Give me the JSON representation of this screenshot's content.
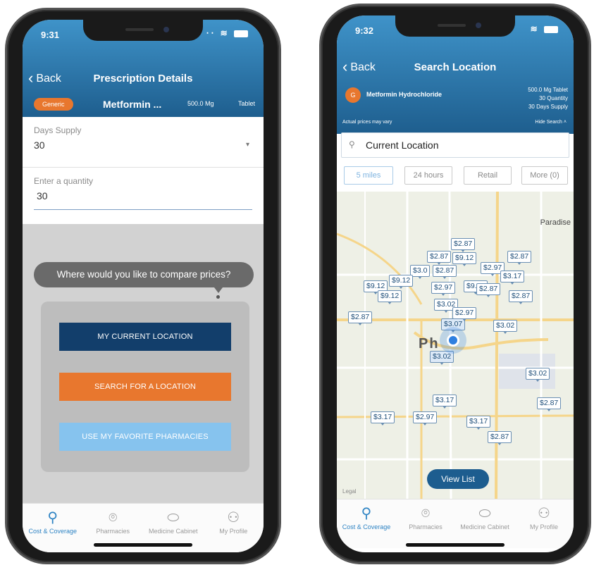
{
  "left_phone": {
    "status_time": "9:31",
    "back_label": "Back",
    "title": "Prescription Details",
    "generic_badge": "Generic",
    "drug_name": "Metformin ...",
    "dose": "500.0 Mg",
    "form": "Tablet",
    "days_supply_label": "Days Supply",
    "days_supply_value": "30",
    "quantity_label": "Enter a quantity",
    "quantity_value": "30",
    "compare_prompt": "Where would you like to compare prices?",
    "btn_current": "MY CURRENT LOCATION",
    "btn_search": "SEARCH FOR A LOCATION",
    "btn_favorite": "USE MY FAVORITE PHARMACIES"
  },
  "right_phone": {
    "status_time": "9:32",
    "back_label": "Back",
    "title": "Search Location",
    "drug_name": "Metformin Hydrochloride",
    "drug_badge": "G",
    "detail_line1": "500.0 Mg Tablet",
    "detail_line2": "30 Quantity",
    "detail_line3": "30 Days Supply",
    "disclaimer": "Actual prices may vary",
    "hide_search": "Hide Search",
    "search_value": "Current Location",
    "filters": [
      "5 miles",
      "24 hours",
      "Retail",
      "More (0)"
    ],
    "map_labels": {
      "paradise": "Paradise",
      "city": "Ph",
      "maps_mark": "Legal"
    },
    "price_pins": [
      {
        "price": "$2.87"
      },
      {
        "price": "$2.87"
      },
      {
        "price": "$9.12"
      },
      {
        "price": "$2.87"
      },
      {
        "price": "$2.97"
      },
      {
        "price": "$3.0"
      },
      {
        "price": "$2.87"
      },
      {
        "price": "$3.17"
      },
      {
        "price": "$9.12"
      },
      {
        "price": "$9.12"
      },
      {
        "price": "$2.97"
      },
      {
        "price": "$9.12"
      },
      {
        "price": "$2.87"
      },
      {
        "price": "$9.12"
      },
      {
        "price": "$2.87"
      },
      {
        "price": "$2.87"
      },
      {
        "price": "$3.02"
      },
      {
        "price": "$3.07"
      },
      {
        "price": "$2.97"
      },
      {
        "price": "$3.02"
      },
      {
        "price": "$3.02"
      },
      {
        "price": "$3.02"
      },
      {
        "price": "$2.87"
      },
      {
        "price": "$3.17"
      },
      {
        "price": "$3.17"
      },
      {
        "price": "$2.97"
      },
      {
        "price": "$3.17"
      },
      {
        "price": "$2.87"
      }
    ],
    "view_list": "View List"
  },
  "tabs": [
    "Cost & Coverage",
    "Pharmacies",
    "Medicine Cabinet",
    "My Profile"
  ],
  "colors": {
    "header_blue": "#2b73ab",
    "accent_orange": "#e8772e",
    "navy_button": "#123e6b",
    "light_blue_button": "#86c3ee",
    "tab_active": "#2f84c4"
  }
}
